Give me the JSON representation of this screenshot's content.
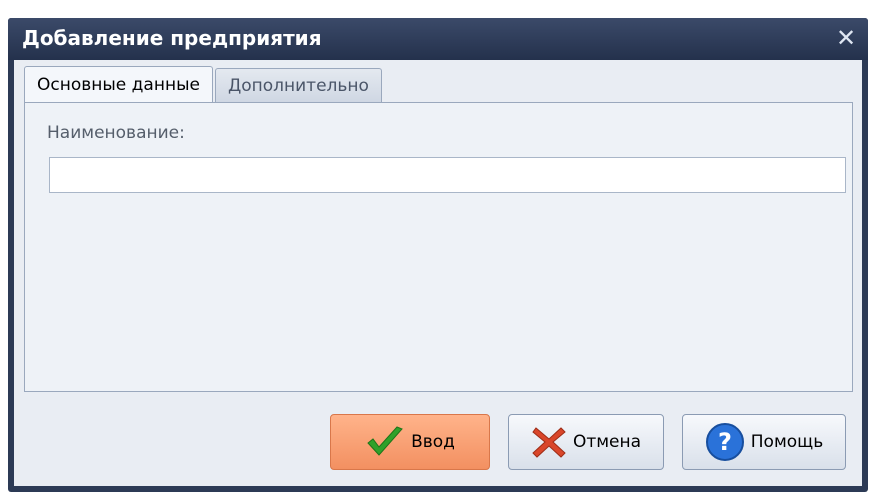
{
  "window": {
    "title": "Добавление предприятия",
    "close_icon": "close-icon"
  },
  "tabs": [
    {
      "label": "Основные данные",
      "active": true
    },
    {
      "label": "Дополнительно",
      "active": false
    }
  ],
  "form": {
    "name_label": "Наименование:",
    "name_value": "",
    "name_placeholder": ""
  },
  "buttons": {
    "ok_label": "Ввод",
    "ok_icon": "check-icon",
    "cancel_label": "Отмена",
    "cancel_icon": "cross-icon",
    "help_label": "Помощь",
    "help_icon": "help-icon"
  },
  "colors": {
    "titlebar": "#2c3a55",
    "primary_button": "#f39061",
    "check_green": "#2fa12a",
    "cross_red": "#d9462a",
    "help_blue": "#2a72d9"
  }
}
